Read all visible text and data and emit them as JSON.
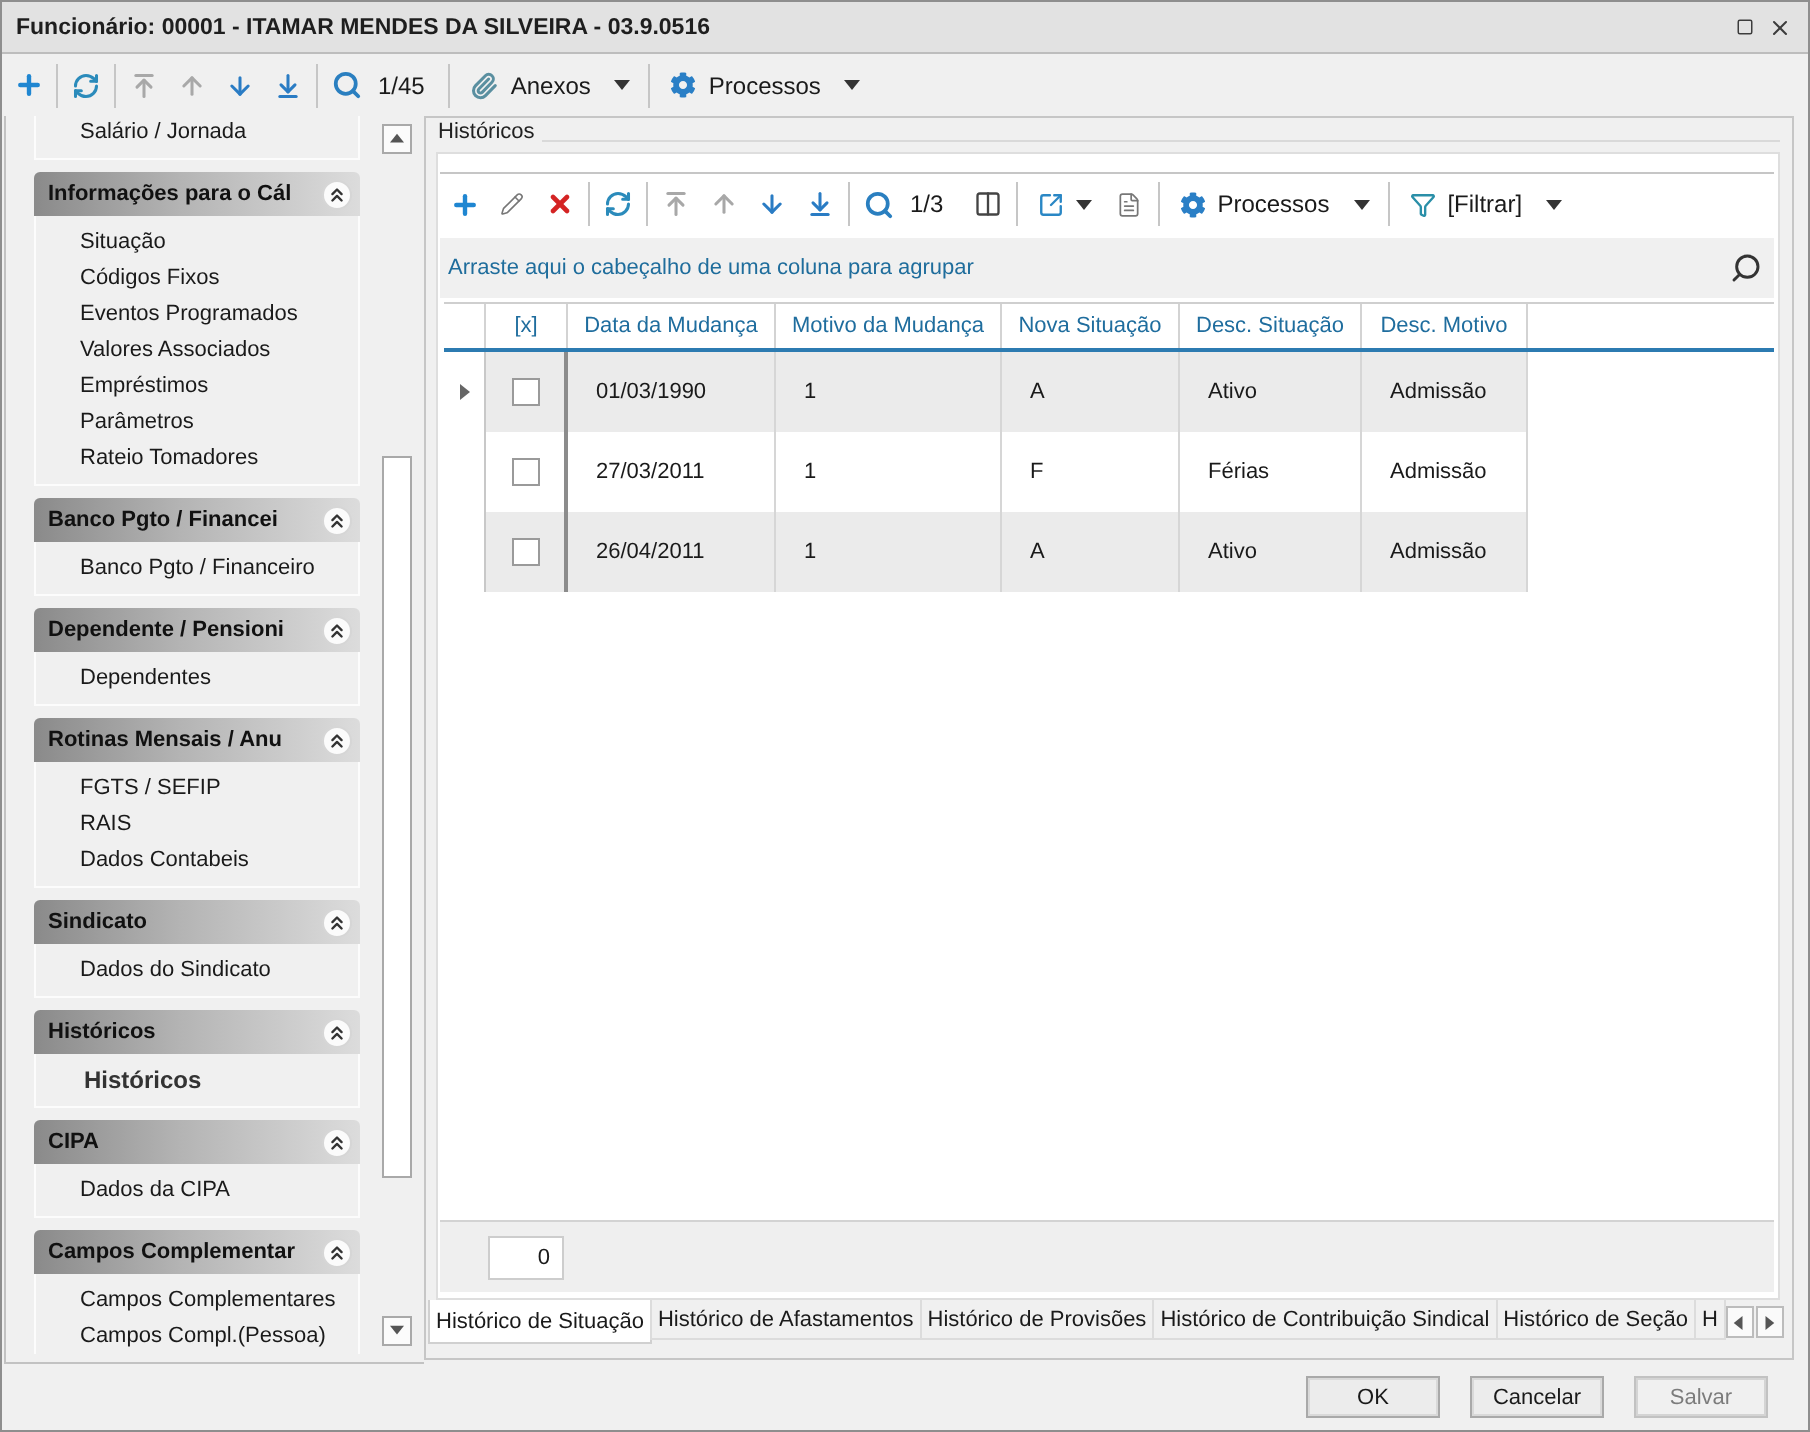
{
  "window": {
    "title": "Funcionário: 00001 - ITAMAR MENDES DA SILVEIRA - 03.9.0516"
  },
  "toolbar": {
    "nav": [
      {
        "kind": "first",
        "disabled": true
      },
      {
        "kind": "previous",
        "disabled": true
      },
      {
        "kind": "next",
        "disabled": false
      },
      {
        "kind": "last",
        "disabled": false
      }
    ],
    "record_counter": "1/45",
    "menus": [
      {
        "kind": "attachments",
        "label": "Anexos"
      },
      {
        "kind": "processes",
        "label": "Processos"
      }
    ]
  },
  "sidebar": {
    "groups": [
      {
        "items": [
          {
            "label": "Salário / Jornada",
            "selected": false
          }
        ]
      },
      {
        "title": "Informações para o Cál",
        "expanded": true,
        "items": [
          {
            "label": "Situação",
            "selected": false
          },
          {
            "label": "Códigos Fixos",
            "selected": false
          },
          {
            "label": "Eventos Programados",
            "selected": false
          },
          {
            "label": "Valores Associados",
            "selected": false
          },
          {
            "label": "Empréstimos",
            "selected": false
          },
          {
            "label": "Parâmetros",
            "selected": false
          },
          {
            "label": "Rateio Tomadores",
            "selected": false
          }
        ]
      },
      {
        "title": "Banco Pgto / Financei",
        "expanded": true,
        "items": [
          {
            "label": "Banco Pgto / Financeiro",
            "selected": false
          }
        ]
      },
      {
        "title": "Dependente / Pensioni",
        "expanded": true,
        "items": [
          {
            "label": "Dependentes",
            "selected": false
          }
        ]
      },
      {
        "title": "Rotinas Mensais / Anu",
        "expanded": true,
        "items": [
          {
            "label": "FGTS / SEFIP",
            "selected": false
          },
          {
            "label": "RAIS",
            "selected": false
          },
          {
            "label": "Dados Contabeis",
            "selected": false
          }
        ]
      },
      {
        "title": "Sindicato",
        "expanded": true,
        "items": [
          {
            "label": "Dados do Sindicato",
            "selected": false
          }
        ]
      },
      {
        "title": "Históricos",
        "expanded": true,
        "items": [
          {
            "label": "Históricos",
            "selected": true
          }
        ]
      },
      {
        "title": "CIPA",
        "expanded": true,
        "items": [
          {
            "label": "Dados da CIPA",
            "selected": false
          }
        ]
      },
      {
        "title": "Campos Complementar",
        "expanded": true,
        "items": [
          {
            "label": "Campos Complementares",
            "selected": false
          },
          {
            "label": "Campos Compl.(Pessoa)",
            "selected": false
          }
        ]
      }
    ]
  },
  "panel": {
    "title": "Históricos",
    "toolbar": {
      "nav": [
        {
          "kind": "first",
          "disabled": true
        },
        {
          "kind": "previous",
          "disabled": true
        },
        {
          "kind": "next",
          "disabled": false
        },
        {
          "kind": "last",
          "disabled": false
        }
      ],
      "record_counter": "1/3",
      "menus": [
        {
          "kind": "processes",
          "label": "Processos"
        },
        {
          "kind": "filter",
          "label": "[Filtrar]"
        }
      ]
    },
    "group_hint": "Arraste aqui o cabeçalho de uma coluna para agrupar",
    "table": {
      "check_column": "[x]",
      "columns": [
        "Data da Mudança",
        "Motivo da Mudança",
        "Nova Situação",
        "Desc. Situação",
        "Desc. Motivo"
      ],
      "rows": [
        {
          "current": true,
          "checked": false,
          "cells": [
            "01/03/1990",
            "1",
            "A",
            "Ativo",
            "Admissão"
          ]
        },
        {
          "current": false,
          "checked": false,
          "cells": [
            "27/03/2011",
            "1",
            "F",
            "Férias",
            "Admissão"
          ]
        },
        {
          "current": false,
          "checked": false,
          "cells": [
            "26/04/2011",
            "1",
            "A",
            "Ativo",
            "Admissão"
          ]
        }
      ]
    },
    "footer": {
      "count": "0"
    }
  },
  "tabs": [
    {
      "label": "Histórico de Situação",
      "selected": true
    },
    {
      "label": "Histórico de Afastamentos",
      "selected": false
    },
    {
      "label": "Histórico de Provisões",
      "selected": false
    },
    {
      "label": "Histórico de Contribuição Sindical",
      "selected": false
    },
    {
      "label": "Histórico de Seção",
      "selected": false
    },
    {
      "label": "H",
      "selected": false
    }
  ],
  "buttons": [
    {
      "label": "OK",
      "disabled": false
    },
    {
      "label": "Cancelar",
      "disabled": false
    },
    {
      "label": "Salvar",
      "disabled": true
    }
  ]
}
